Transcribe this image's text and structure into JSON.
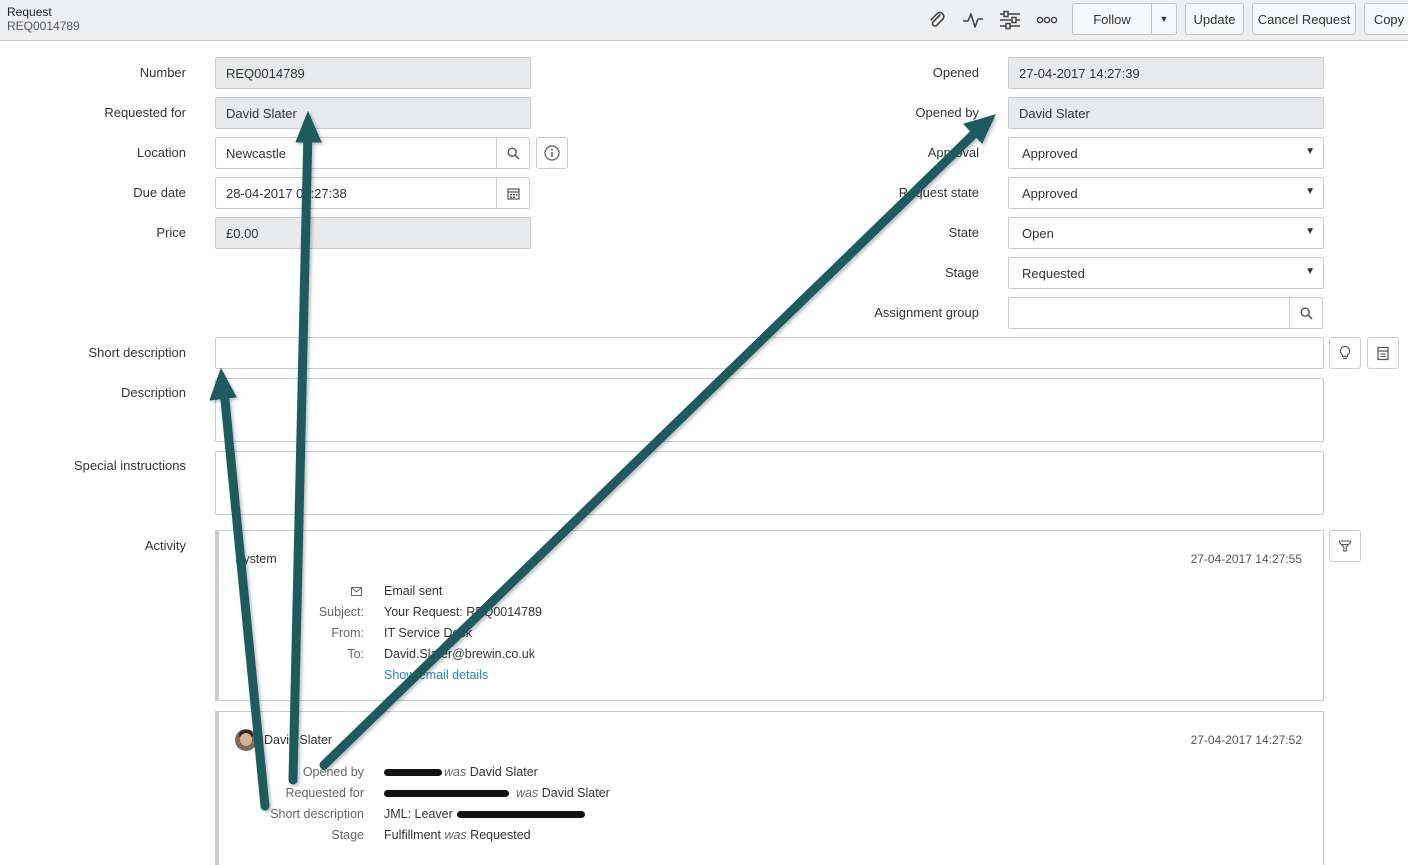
{
  "header": {
    "title": "Request",
    "number": "REQ0014789",
    "icons": [
      "paperclip-icon",
      "activity-icon",
      "sliders-icon",
      "more-icon"
    ],
    "follow_label": "Follow",
    "update_label": "Update",
    "cancel_label": "Cancel Request",
    "copy_label": "Copy"
  },
  "form": {
    "number": {
      "label": "Number",
      "value": "REQ0014789"
    },
    "requested_for": {
      "label": "Requested for",
      "value": "David Slater"
    },
    "location": {
      "label": "Location",
      "value": "Newcastle"
    },
    "due_date": {
      "label": "Due date",
      "value": "28-04-2017 04:27:38"
    },
    "price": {
      "label": "Price",
      "value": "£0.00"
    },
    "opened": {
      "label": "Opened",
      "value": "27-04-2017 14:27:39"
    },
    "opened_by": {
      "label": "Opened by",
      "value": "David Slater"
    },
    "approval": {
      "label": "Approval",
      "value": "Approved"
    },
    "request_state": {
      "label": "Request state",
      "value": "Approved"
    },
    "state": {
      "label": "State",
      "value": "Open"
    },
    "stage": {
      "label": "Stage",
      "value": "Requested"
    },
    "assignment_group": {
      "label": "Assignment group",
      "value": ""
    },
    "short_description": {
      "label": "Short description",
      "value": ""
    },
    "description": {
      "label": "Description",
      "value": ""
    },
    "special_instructions": {
      "label": "Special instructions",
      "value": ""
    }
  },
  "activity": {
    "label": "Activity",
    "entries": [
      {
        "author": "System",
        "time": "27-04-2017 14:27:55",
        "type": "Email sent",
        "subject_label": "Subject:",
        "subject": "Your Request: REQ0014789",
        "from_label": "From:",
        "from": "IT Service Desk",
        "to_label": "To:",
        "to": "David.Slater@brewin.co.uk",
        "link": "Show email details"
      },
      {
        "author": "David Slater",
        "time": "27-04-2017 14:27:52",
        "changes": [
          {
            "field": "Opened by",
            "new": "",
            "was": "was",
            "old": "David Slater"
          },
          {
            "field": "Requested for",
            "new": "",
            "was": "was",
            "old": "David Slater"
          },
          {
            "field": "Short description",
            "new": "JML: Leaver -",
            "was": "",
            "old": ""
          },
          {
            "field": "Stage",
            "new": "Fulfillment",
            "was": "was",
            "old": "Requested"
          }
        ]
      }
    ]
  },
  "colors": {
    "arrow": "#1a5c5e",
    "link": "#1e84c7",
    "readonly_bg": "#e8e9eb",
    "header_bg": "#eeeff1"
  }
}
